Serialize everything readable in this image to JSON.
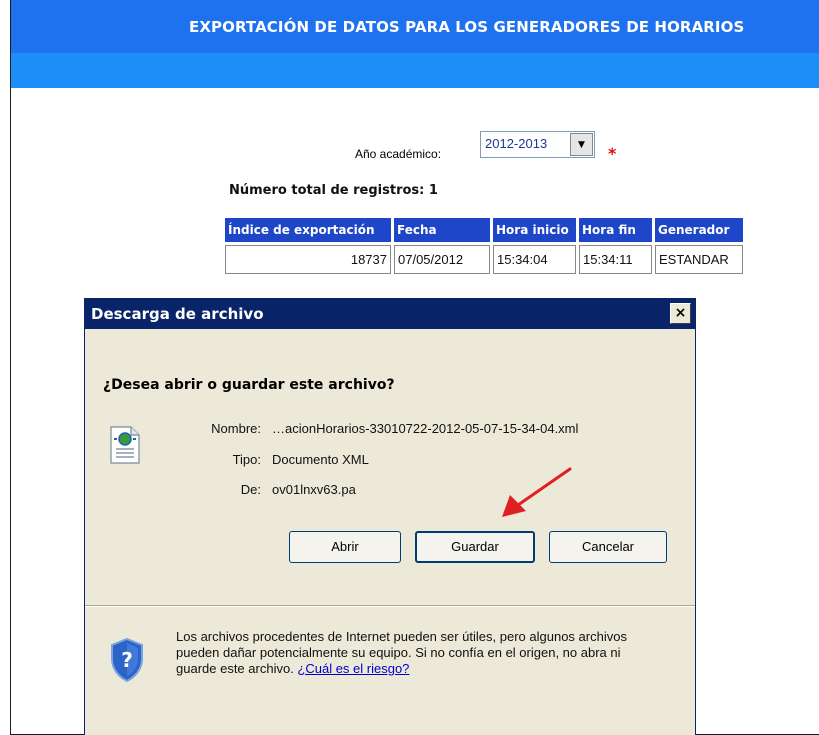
{
  "page": {
    "title": "EXPORTACIÓN DE DATOS PARA LOS GENERADORES DE HORARIOS",
    "year_label": "Año académico:",
    "year_value": "2012-2013",
    "required_mark": "*",
    "total_records": "Número total de registros: 1"
  },
  "table": {
    "headers": [
      "Índice de exportación",
      "Fecha",
      "Hora inicio",
      "Hora fin",
      "Generador"
    ],
    "rows": [
      [
        "18737",
        "07/05/2012",
        "15:34:04",
        "15:34:11",
        "ESTANDAR"
      ]
    ]
  },
  "dialog": {
    "title": "Descarga de archivo",
    "close_glyph": "×",
    "question": "¿Desea abrir o guardar este archivo?",
    "name_label": "Nombre:",
    "name_value": "…acionHorarios-33010722-2012-05-07-15-34-04.xml",
    "type_label": "Tipo:",
    "type_value": "Documento XML",
    "from_label": "De:",
    "from_value": "ov01lnxv63.pa",
    "buttons": {
      "open": "Abrir",
      "save": "Guardar",
      "cancel": "Cancelar"
    },
    "warning_text": "Los archivos procedentes de Internet pueden ser útiles, pero algunos archivos pueden dañar potencialmente su equipo. Si no confía en el origen, no abra ni guarde este archivo. ",
    "warning_link": "¿Cuál es el riesgo?"
  },
  "colors": {
    "header_bar": "#1e72f0",
    "sub_bar": "#1d8ef7",
    "table_header": "#1e46c8",
    "dialog_title": "#0a246a",
    "dialog_bg": "#ece9d8",
    "arrow": "#e02020"
  },
  "icons": [
    "file-xml-icon",
    "shield-question-icon",
    "close-icon",
    "dropdown-arrow-icon",
    "red-arrow-icon"
  ]
}
